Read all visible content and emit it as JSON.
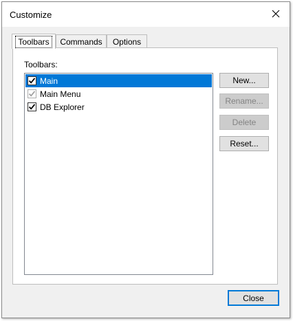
{
  "window": {
    "title": "Customize"
  },
  "tabs": [
    {
      "label": "Toolbars"
    },
    {
      "label": "Commands"
    },
    {
      "label": "Options"
    }
  ],
  "toolbars_panel": {
    "group_label": "Toolbars:",
    "items": [
      {
        "label": "Main",
        "checked": true,
        "selected": true,
        "enabled": true
      },
      {
        "label": "Main Menu",
        "checked": true,
        "selected": false,
        "enabled": false
      },
      {
        "label": "DB Explorer",
        "checked": true,
        "selected": false,
        "enabled": true
      }
    ],
    "buttons": {
      "new_label": "New...",
      "rename_label": "Rename...",
      "delete_label": "Delete",
      "reset_label": "Reset..."
    }
  },
  "footer": {
    "close_label": "Close"
  },
  "colors": {
    "selection": "#0078d7",
    "default_button_border": "#0078d7",
    "dialog_background": "#f0f0f0"
  },
  "icons": {
    "close": "close-icon",
    "check": "checkmark-icon"
  }
}
